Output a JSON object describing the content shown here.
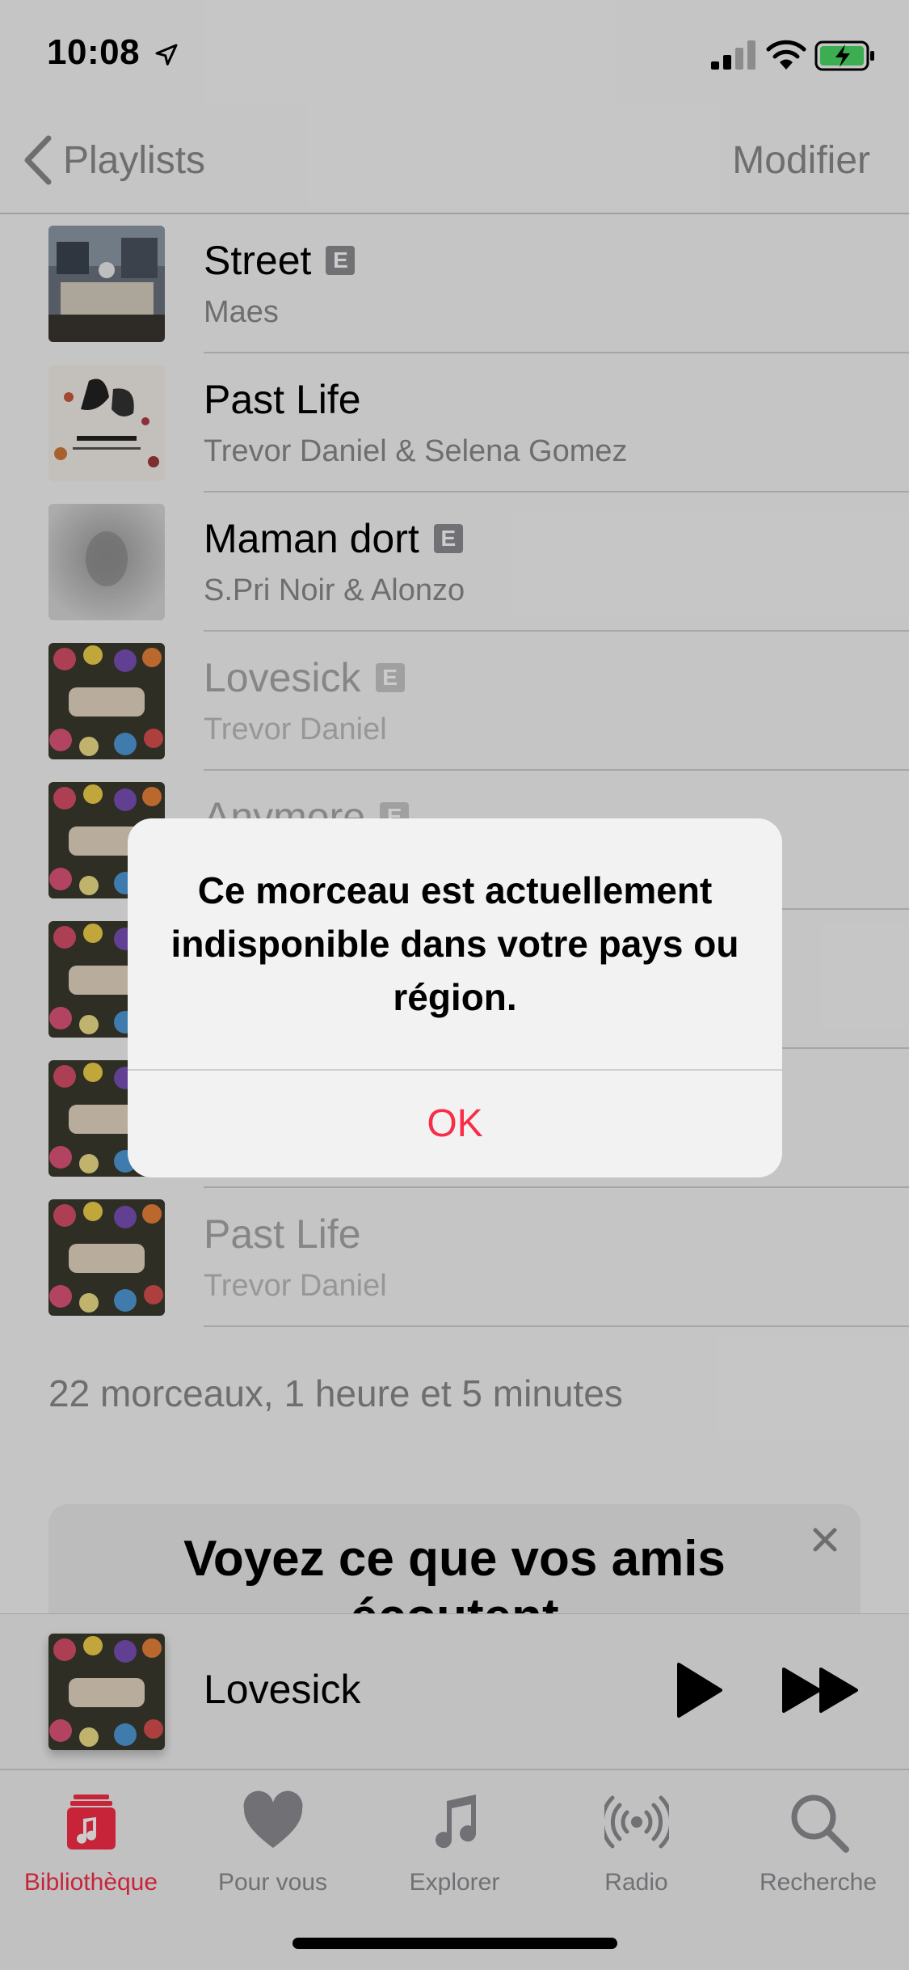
{
  "status_bar": {
    "time": "10:08"
  },
  "nav": {
    "back_label": "Playlists",
    "edit_label": "Modifier"
  },
  "tracks": [
    {
      "title": "Street",
      "artist": "Maes",
      "explicit": true,
      "art": "street"
    },
    {
      "title": "Past Life",
      "artist": "Trevor Daniel & Selena Gomez",
      "explicit": false,
      "art": "pastlife"
    },
    {
      "title": "Maman dort",
      "artist": "S.Pri Noir & Alonzo",
      "explicit": true,
      "art": "maman"
    },
    {
      "title": "Lovesick",
      "artist": "Trevor Daniel",
      "explicit": true,
      "art": "flowers"
    },
    {
      "title": "Anymore",
      "artist": "",
      "explicit": true,
      "art": "flowers"
    },
    {
      "title": "",
      "artist": "",
      "explicit": false,
      "art": "flowers"
    },
    {
      "title": "",
      "artist": "",
      "explicit": false,
      "art": "flowers"
    },
    {
      "title": "Past Life",
      "artist": "Trevor Daniel",
      "explicit": false,
      "art": "flowers"
    }
  ],
  "explicit_badge": "E",
  "summary": "22 morceaux, 1 heure et 5 minutes",
  "friends_card": {
    "title": "Voyez ce que vos amis écoutent"
  },
  "mini_player": {
    "title": "Lovesick"
  },
  "tabs": [
    {
      "label": "Bibliothèque",
      "icon": "library-icon",
      "active": true
    },
    {
      "label": "Pour vous",
      "icon": "heart-icon",
      "active": false
    },
    {
      "label": "Explorer",
      "icon": "music-note-icon",
      "active": false
    },
    {
      "label": "Radio",
      "icon": "radio-icon",
      "active": false
    },
    {
      "label": "Recherche",
      "icon": "search-icon",
      "active": false
    }
  ],
  "alert": {
    "message": "Ce morceau est actuellement indisponible dans votre pays ou région.",
    "ok_label": "OK"
  },
  "colors": {
    "accent": "#fa2d48",
    "secondary_text": "#8a8a8a"
  }
}
